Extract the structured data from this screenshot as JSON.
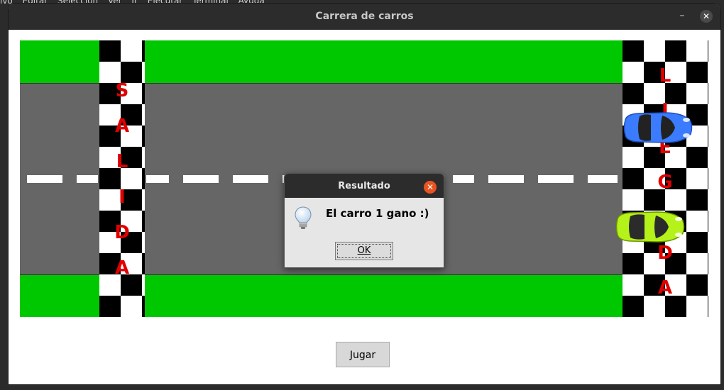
{
  "background_menu": [
    "ivo",
    "Editar",
    "Selección",
    "Ver",
    "Ir",
    "Ejecutar",
    "Terminal",
    "Ayuda"
  ],
  "window": {
    "title": "Carrera de carros",
    "minimize_icon": "minimize-icon",
    "close_icon": "close-icon"
  },
  "track": {
    "start_label_letters": [
      "S",
      "A",
      "L",
      "I",
      "D",
      "A"
    ],
    "finish_label_letters": [
      "L",
      "I",
      "E",
      "G",
      "D",
      "A"
    ],
    "colors": {
      "grass": "#00c800",
      "road": "#666666",
      "lane_marking": "#ffffff",
      "label": "#e00000"
    },
    "cars": [
      {
        "name": "blue-car",
        "color": "#3a7bff"
      },
      {
        "name": "lime-car",
        "color": "#b5f21a"
      }
    ]
  },
  "play_button": {
    "label": "Jugar"
  },
  "dialog": {
    "title": "Resultado",
    "message": "El carro 1 gano :)",
    "ok_label": "OK",
    "icon": "lightbulb-icon",
    "close_icon_color": "#e95420"
  }
}
